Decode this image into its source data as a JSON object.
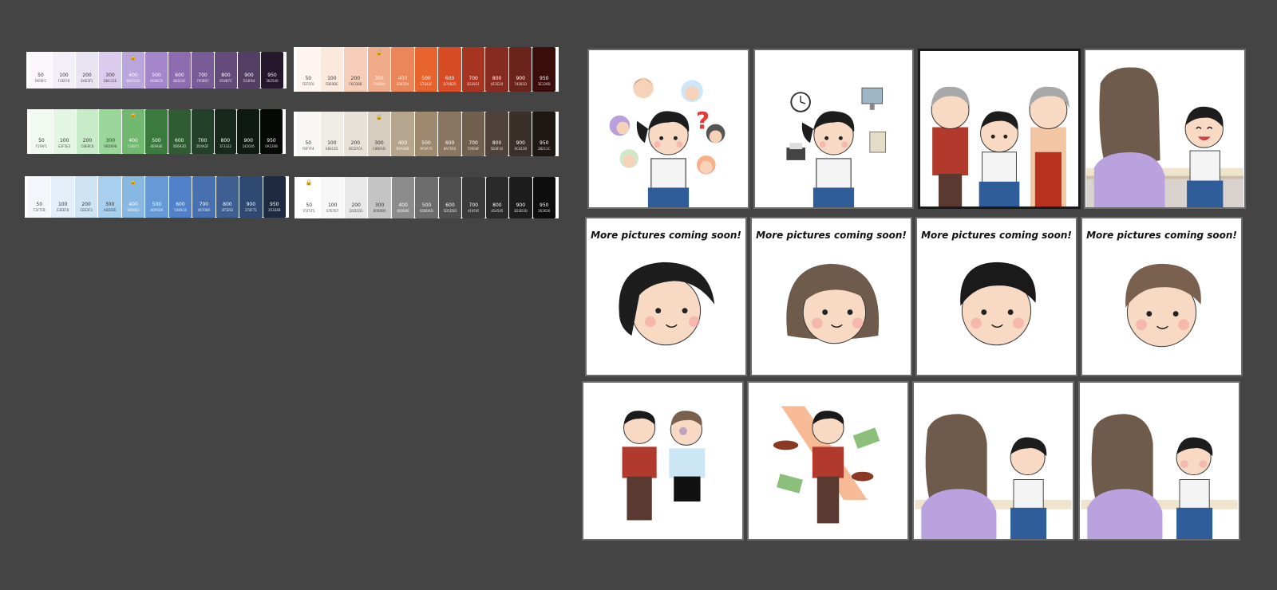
{
  "palettes": [
    {
      "id": "purple",
      "swatches": [
        {
          "step": "50",
          "hex": "FAF6FC",
          "color": "#faf6fc",
          "text": "#333"
        },
        {
          "step": "100",
          "hex": "F3EFF8",
          "color": "#f3eff8",
          "text": "#333"
        },
        {
          "step": "200",
          "hex": "EAE3F1",
          "color": "#eae3f1",
          "text": "#333"
        },
        {
          "step": "300",
          "hex": "DBCCEE",
          "color": "#dbccee",
          "text": "#333"
        },
        {
          "step": "400",
          "hex": "BBA5DD",
          "color": "#bba5dd",
          "text": "#fff",
          "lock": true
        },
        {
          "step": "500",
          "hex": "A686CB",
          "color": "#a686cb",
          "text": "#fff"
        },
        {
          "step": "600",
          "hex": "8E6CAF",
          "color": "#8e6caf",
          "text": "#fff"
        },
        {
          "step": "700",
          "hex": "795B97",
          "color": "#795b97",
          "text": "#fff"
        },
        {
          "step": "800",
          "hex": "654B7C",
          "color": "#654b7c",
          "text": "#fff"
        },
        {
          "step": "900",
          "hex": "533F64",
          "color": "#533f64",
          "text": "#fff"
        },
        {
          "step": "950",
          "hex": "362546",
          "color": "#25172c",
          "text": "#fff"
        }
      ]
    },
    {
      "id": "orange",
      "swatches": [
        {
          "step": "50",
          "hex": "FEF5F0",
          "color": "#fef5f0",
          "text": "#333"
        },
        {
          "step": "100",
          "hex": "FBE9DE",
          "color": "#fbe9de",
          "text": "#333"
        },
        {
          "step": "200",
          "hex": "F6CDB8",
          "color": "#f6cdb8",
          "text": "#333"
        },
        {
          "step": "300",
          "hex": "F0AB8A",
          "color": "#f0ab8a",
          "text": "#fff",
          "lock": true
        },
        {
          "step": "400",
          "hex": "EB855A",
          "color": "#eb855a",
          "text": "#fff"
        },
        {
          "step": "500",
          "hex": "E7642F",
          "color": "#e7642f",
          "text": "#fff"
        },
        {
          "step": "600",
          "hex": "D74B25",
          "color": "#d74b25",
          "text": "#fff"
        },
        {
          "step": "700",
          "hex": "B33821",
          "color": "#a63420",
          "text": "#fff"
        },
        {
          "step": "800",
          "hex": "8F2E20",
          "color": "#862b1f",
          "text": "#fff"
        },
        {
          "step": "900",
          "hex": "74281D",
          "color": "#6a241c",
          "text": "#fff"
        },
        {
          "step": "950",
          "hex": "3E120D",
          "color": "#3a0d0a",
          "text": "#fff"
        }
      ]
    },
    {
      "id": "green",
      "swatches": [
        {
          "step": "50",
          "hex": "F1FAF1",
          "color": "#f1faf1",
          "text": "#333"
        },
        {
          "step": "100",
          "hex": "E3F5E3",
          "color": "#e3f5e3",
          "text": "#333"
        },
        {
          "step": "200",
          "hex": "C8EBC8",
          "color": "#c8ebc8",
          "text": "#333"
        },
        {
          "step": "300",
          "hex": "9BD69B",
          "color": "#9bd69b",
          "text": "#333"
        },
        {
          "step": "400",
          "hex": "71B871",
          "color": "#71b871",
          "text": "#fff",
          "lock": true
        },
        {
          "step": "500",
          "hex": "4E9A4E",
          "color": "#3b7a3e",
          "text": "#fff"
        },
        {
          "step": "600",
          "hex": "3D6A3D",
          "color": "#2f5c32",
          "text": "#fff"
        },
        {
          "step": "700",
          "hex": "2D4A2F",
          "color": "#22402a",
          "text": "#fff"
        },
        {
          "step": "800",
          "hex": "1F3322",
          "color": "#17281c",
          "text": "#fff"
        },
        {
          "step": "900",
          "hex": "142016",
          "color": "#0f1a12",
          "text": "#fff"
        },
        {
          "step": "950",
          "hex": "0A120B",
          "color": "#050a06",
          "text": "#fff"
        }
      ]
    },
    {
      "id": "taupe",
      "swatches": [
        {
          "step": "50",
          "hex": "F8F7F4",
          "color": "#f8f7f4",
          "text": "#333"
        },
        {
          "step": "100",
          "hex": "EEECE5",
          "color": "#eeece5",
          "text": "#333"
        },
        {
          "step": "200",
          "hex": "DCD7CA",
          "color": "#e7e2d8",
          "text": "#333"
        },
        {
          "step": "300",
          "hex": "C8BFAD",
          "color": "#d6cdbf",
          "text": "#333",
          "lock": true
        },
        {
          "step": "400",
          "hex": "B4A48B",
          "color": "#b6a68f",
          "text": "#fff"
        },
        {
          "step": "500",
          "hex": "9F8A70",
          "color": "#9f8a70",
          "text": "#fff"
        },
        {
          "step": "600",
          "hex": "8A7560",
          "color": "#8a7560",
          "text": "#fff"
        },
        {
          "step": "700",
          "hex": "72604F",
          "color": "#72604f",
          "text": "#fff"
        },
        {
          "step": "800",
          "hex": "5D4F42",
          "color": "#4f423a",
          "text": "#fff"
        },
        {
          "step": "900",
          "hex": "4C4138",
          "color": "#3a3029",
          "text": "#fff"
        },
        {
          "step": "950",
          "hex": "28211C",
          "color": "#1e1814",
          "text": "#fff"
        }
      ]
    },
    {
      "id": "blue",
      "swatches": [
        {
          "step": "50",
          "hex": "F3F7FB",
          "color": "#f3f7fb",
          "text": "#333"
        },
        {
          "step": "100",
          "hex": "E3EEF8",
          "color": "#e3eef8",
          "text": "#333"
        },
        {
          "step": "200",
          "hex": "CEE3F3",
          "color": "#cee3f3",
          "text": "#333"
        },
        {
          "step": "300",
          "hex": "A8D0EE",
          "color": "#a8d0ee",
          "text": "#333"
        },
        {
          "step": "400",
          "hex": "86B8E2",
          "color": "#86b8e2",
          "text": "#fff",
          "lock": true
        },
        {
          "step": "500",
          "hex": "6699D6",
          "color": "#6699d6",
          "text": "#fff"
        },
        {
          "step": "600",
          "hex": "5080C8",
          "color": "#5080c8",
          "text": "#fff"
        },
        {
          "step": "700",
          "hex": "4670B0",
          "color": "#4670b0",
          "text": "#fff"
        },
        {
          "step": "800",
          "hex": "3F5E92",
          "color": "#3f5e92",
          "text": "#fff"
        },
        {
          "step": "900",
          "hex": "374F71",
          "color": "#2f4a72",
          "text": "#fff"
        },
        {
          "step": "950",
          "hex": "253348",
          "color": "#1d2a40",
          "text": "#fff"
        }
      ]
    },
    {
      "id": "gray",
      "swatches": [
        {
          "step": "50",
          "hex": "F5F5F5",
          "color": "#ffffff",
          "text": "#333",
          "lock": true
        },
        {
          "step": "100",
          "hex": "E7E7E7",
          "color": "#f7f7f7",
          "text": "#333"
        },
        {
          "step": "200",
          "hex": "D1D1D1",
          "color": "#e8e8e8",
          "text": "#333"
        },
        {
          "step": "300",
          "hex": "B0B0B0",
          "color": "#c4c4c4",
          "text": "#333"
        },
        {
          "step": "400",
          "hex": "888888",
          "color": "#8c8c8c",
          "text": "#fff"
        },
        {
          "step": "500",
          "hex": "6D6D6D",
          "color": "#6d6d6d",
          "text": "#fff"
        },
        {
          "step": "600",
          "hex": "5D5D5D",
          "color": "#4f4f4f",
          "text": "#fff"
        },
        {
          "step": "700",
          "hex": "4F4F4F",
          "color": "#3a3a3a",
          "text": "#fff"
        },
        {
          "step": "800",
          "hex": "454545",
          "color": "#2a2a2a",
          "text": "#fff"
        },
        {
          "step": "900",
          "hex": "3D3D3D",
          "color": "#1c1c1c",
          "text": "#fff"
        },
        {
          "step": "950",
          "hex": "262626",
          "color": "#0d0d0d",
          "text": "#fff"
        }
      ]
    }
  ],
  "coming_soon": "More pictures coming soon!"
}
